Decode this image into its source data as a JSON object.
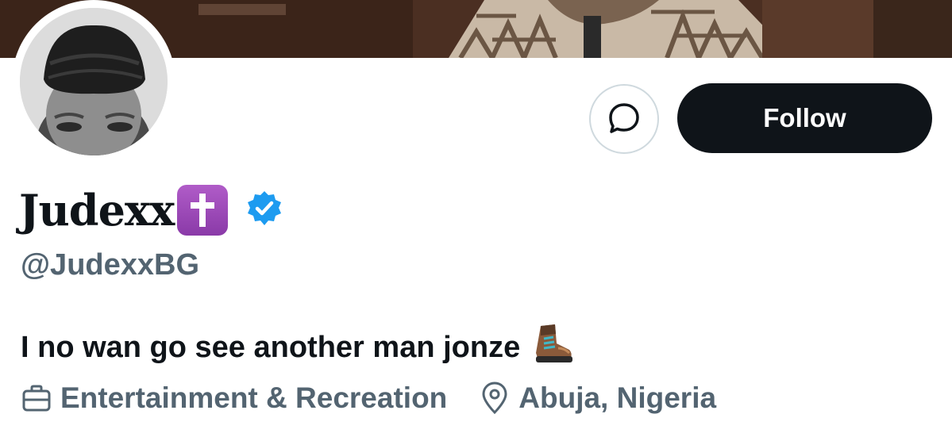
{
  "profile": {
    "display_name": "Judexx",
    "handle": "@JudexxBG",
    "bio": "I no wan go see another man jonze",
    "category": "Entertainment & Recreation",
    "location": "Abuja, Nigeria"
  },
  "actions": {
    "follow_label": "Follow"
  },
  "icons": {
    "message": "message-bubble-icon",
    "verified": "verified-badge-icon",
    "name_emoji": "latin-cross-emoji",
    "bio_emoji": "hiking-boot-emoji",
    "category": "briefcase-icon",
    "location": "map-pin-icon"
  },
  "colors": {
    "text_primary": "#0f1419",
    "text_secondary": "#536471",
    "follow_bg": "#0f1419",
    "verified_blue": "#1d9bf0",
    "emoji_purple": "#9a47b8"
  }
}
